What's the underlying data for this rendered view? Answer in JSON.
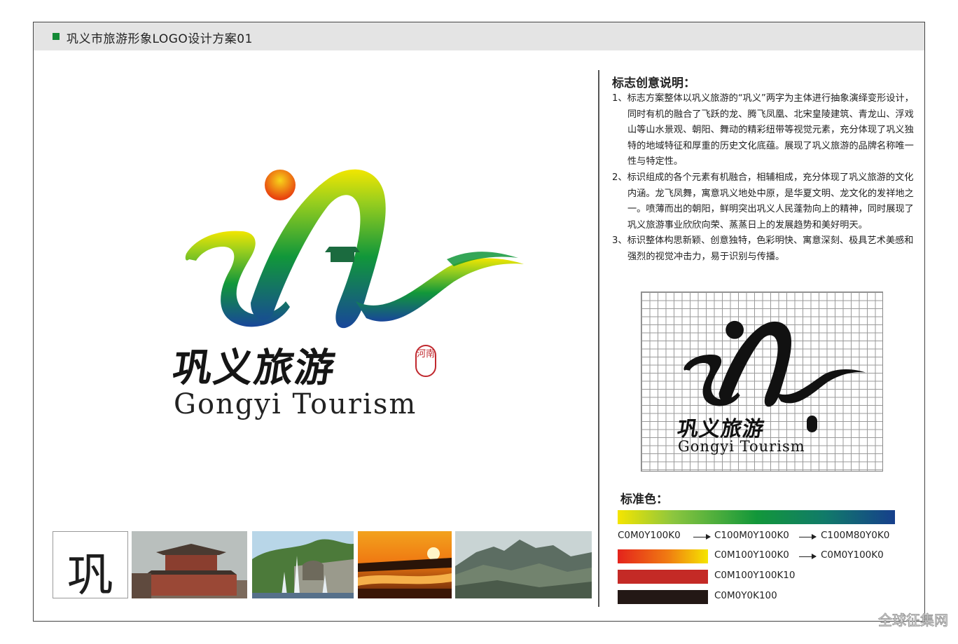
{
  "header": {
    "title": "巩义市旅游形象LOGO设计方案01"
  },
  "logo": {
    "cn_name": "巩义旅游",
    "en_name": "Gongyi Tourism",
    "seal_text": "河南"
  },
  "thumbnail_char": "巩",
  "description": {
    "title": "标志创意说明：",
    "items": [
      "1、标志方案整体以巩义旅游的“巩义”两字为主体进行抽象演绎变形设计，同时有机的融合了飞跃的龙、腾飞凤凰、北宋皇陵建筑、青龙山、浮戏山等山水景观、朝阳、舞动的精彩纽带等视觉元素，充分体现了巩义独特的地域特征和厚重的历史文化底蕴。展现了巩义旅游的品牌名称唯一性与特定性。",
      "2、标识组成的各个元素有机融合，相辅相成，充分体现了巩义旅游的文化内涵。龙飞凤舞，寓意巩义地处中原，是华夏文明、龙文化的发祥地之一。喷薄而出的朝阳，鲜明突出巩义人民蓬勃向上的精神，同时展现了巩义旅游事业欣欣向荣、蒸蒸日上的发展趋势和美好明天。",
      "3、标识整体构思新颖、创意独特，色彩明快、寓意深刻、极具艺术美感和强烈的视觉冲击力，易于识别与传播。"
    ]
  },
  "grid_logo": {
    "cn_name": "巩义旅游",
    "en_name": "Gongyi Tourism"
  },
  "standard_colors": {
    "title": "标准色：",
    "gradient_labels": [
      "C0M0Y100K0",
      "C100M0Y100K0",
      "C100M80Y0K0"
    ],
    "orange_labels": [
      "C0M100Y100K0",
      "C0M0Y100K0"
    ],
    "red_label": "C0M100Y100K10",
    "black_label": "C0M0Y0K100",
    "colors": {
      "yellow": "#f5e500",
      "green": "#12973a",
      "blue": "#163f8c",
      "red": "#e4231c",
      "dark_red": "#c42a26",
      "black": "#231815"
    }
  },
  "watermark": "全球征集网"
}
